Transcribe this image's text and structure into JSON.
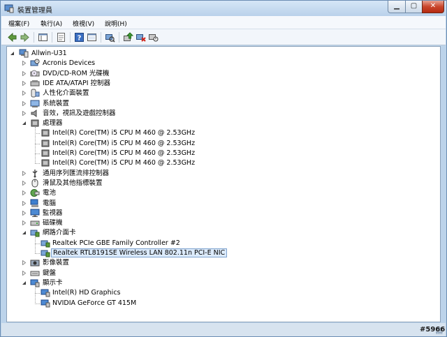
{
  "window": {
    "title": "裝置管理員",
    "controls": {
      "minimize": "▁",
      "maximize": "▢",
      "close": "✕"
    }
  },
  "menubar": [
    {
      "label": "檔案(F)"
    },
    {
      "label": "執行(A)"
    },
    {
      "label": "檢視(V)"
    },
    {
      "label": "說明(H)"
    }
  ],
  "toolbar": {
    "icons": [
      "back-arrow-icon",
      "forward-arrow-icon",
      "console-tree-icon",
      "properties-icon",
      "help-icon",
      "console-icon",
      "scan-hardware-icon",
      "update-driver-icon",
      "uninstall-icon",
      "disable-device-icon"
    ]
  },
  "tree": {
    "root": "Allwin-U31",
    "categories": [
      {
        "label": "Acronis Devices",
        "expanded": false,
        "children": []
      },
      {
        "label": "DVD/CD-ROM 光碟機",
        "expanded": false,
        "children": []
      },
      {
        "label": "IDE ATA/ATAPI 控制器",
        "expanded": false,
        "children": []
      },
      {
        "label": "人性化介面裝置",
        "expanded": false,
        "children": []
      },
      {
        "label": "系統裝置",
        "expanded": false,
        "children": []
      },
      {
        "label": "音效，視訊及遊戲控制器",
        "expanded": false,
        "children": []
      },
      {
        "label": "處理器",
        "expanded": true,
        "children": [
          "Intel(R) Core(TM) i5 CPU       M 460  @ 2.53GHz",
          "Intel(R) Core(TM) i5 CPU       M 460  @ 2.53GHz",
          "Intel(R) Core(TM) i5 CPU       M 460  @ 2.53GHz",
          "Intel(R) Core(TM) i5 CPU       M 460  @ 2.53GHz"
        ]
      },
      {
        "label": "通用序列匯流排控制器",
        "expanded": false,
        "children": []
      },
      {
        "label": "滑鼠及其他指標裝置",
        "expanded": false,
        "children": []
      },
      {
        "label": "電池",
        "expanded": false,
        "children": []
      },
      {
        "label": "電腦",
        "expanded": false,
        "children": []
      },
      {
        "label": "監視器",
        "expanded": false,
        "children": []
      },
      {
        "label": "磁碟機",
        "expanded": false,
        "children": []
      },
      {
        "label": "網路介面卡",
        "expanded": true,
        "children": [
          "Realtek PCIe GBE Family Controller #2",
          "Realtek RTL8191SE Wireless LAN 802.11n PCI-E NIC"
        ]
      },
      {
        "label": "影像裝置",
        "expanded": false,
        "children": []
      },
      {
        "label": "鍵盤",
        "expanded": false,
        "children": []
      },
      {
        "label": "顯示卡",
        "expanded": true,
        "children": [
          "Intel(R) HD Graphics",
          "NVIDIA GeForce GT 415M"
        ]
      }
    ],
    "selected": "Realtek RTL8191SE Wireless LAN 802.11n PCI-E NIC"
  },
  "watermark": "#5966",
  "colors": {
    "selection_bg": "#dcebfc",
    "selection_border": "#7da2ce",
    "frame": "#bcd3ea"
  }
}
